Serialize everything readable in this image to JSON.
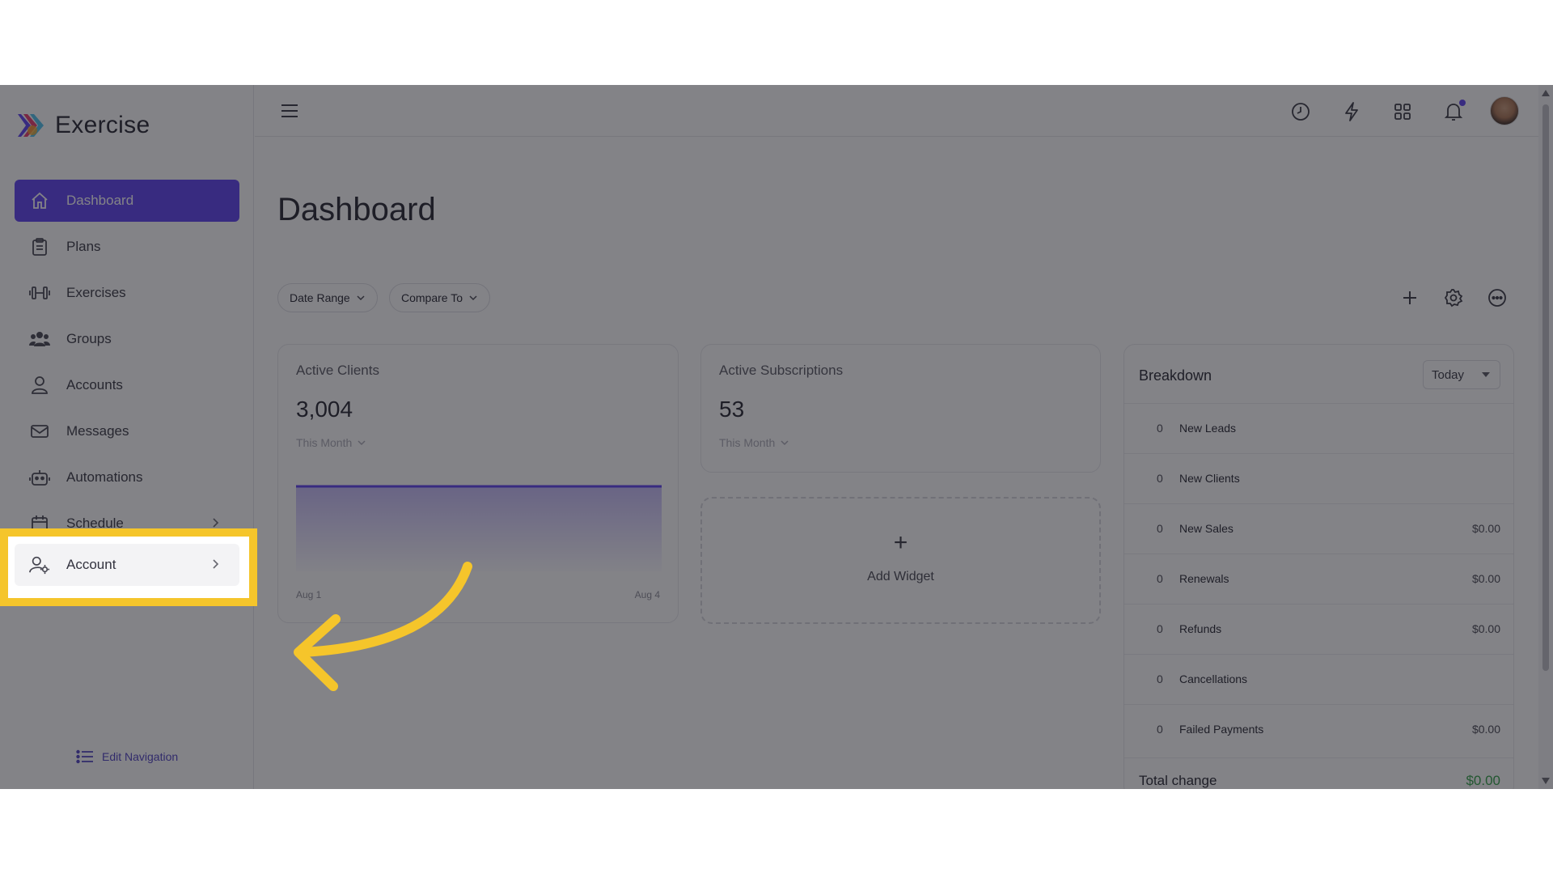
{
  "app": {
    "name": "Exercise"
  },
  "sidebar": {
    "items": [
      {
        "label": "Dashboard",
        "icon": "home-icon",
        "active": true
      },
      {
        "label": "Plans",
        "icon": "clipboard-icon"
      },
      {
        "label": "Exercises",
        "icon": "dumbbell-icon"
      },
      {
        "label": "Groups",
        "icon": "users-icon"
      },
      {
        "label": "Accounts",
        "icon": "user-icon"
      },
      {
        "label": "Messages",
        "icon": "mail-icon"
      },
      {
        "label": "Automations",
        "icon": "robot-icon"
      },
      {
        "label": "Schedule",
        "icon": "calendar-icon"
      }
    ],
    "highlighted_item": {
      "label": "Account",
      "icon": "user-gear-icon"
    },
    "edit_navigation": "Edit Navigation"
  },
  "topbar": {
    "icons": [
      "menu-icon",
      "clock-icon",
      "bolt-icon",
      "grid-icon",
      "bell-icon",
      "avatar"
    ]
  },
  "main": {
    "title": "Dashboard",
    "filters": {
      "date_range": "Date Range",
      "compare_to": "Compare To"
    },
    "cards": {
      "active_clients": {
        "title": "Active Clients",
        "value": "3,004",
        "period": "This Month",
        "x_start": "Aug 1",
        "x_end": "Aug 4"
      },
      "active_subscriptions": {
        "title": "Active Subscriptions",
        "value": "53",
        "period": "This Month"
      }
    },
    "add_widget": {
      "plus": "+",
      "label": "Add Widget"
    },
    "breakdown": {
      "title": "Breakdown",
      "period": "Today",
      "rows": [
        {
          "count": "0",
          "label": "New Leads",
          "amount": ""
        },
        {
          "count": "0",
          "label": "New Clients",
          "amount": ""
        },
        {
          "count": "0",
          "label": "New Sales",
          "amount": "$0.00"
        },
        {
          "count": "0",
          "label": "Renewals",
          "amount": "$0.00"
        },
        {
          "count": "0",
          "label": "Refunds",
          "amount": "$0.00"
        },
        {
          "count": "0",
          "label": "Cancellations",
          "amount": ""
        },
        {
          "count": "0",
          "label": "Failed Payments",
          "amount": "$0.00"
        }
      ],
      "total_label": "Total change",
      "total_value": "$0.00"
    }
  },
  "colors": {
    "accent": "#5a3cf0",
    "highlight": "#f5c52b",
    "positive": "#2ea043"
  }
}
